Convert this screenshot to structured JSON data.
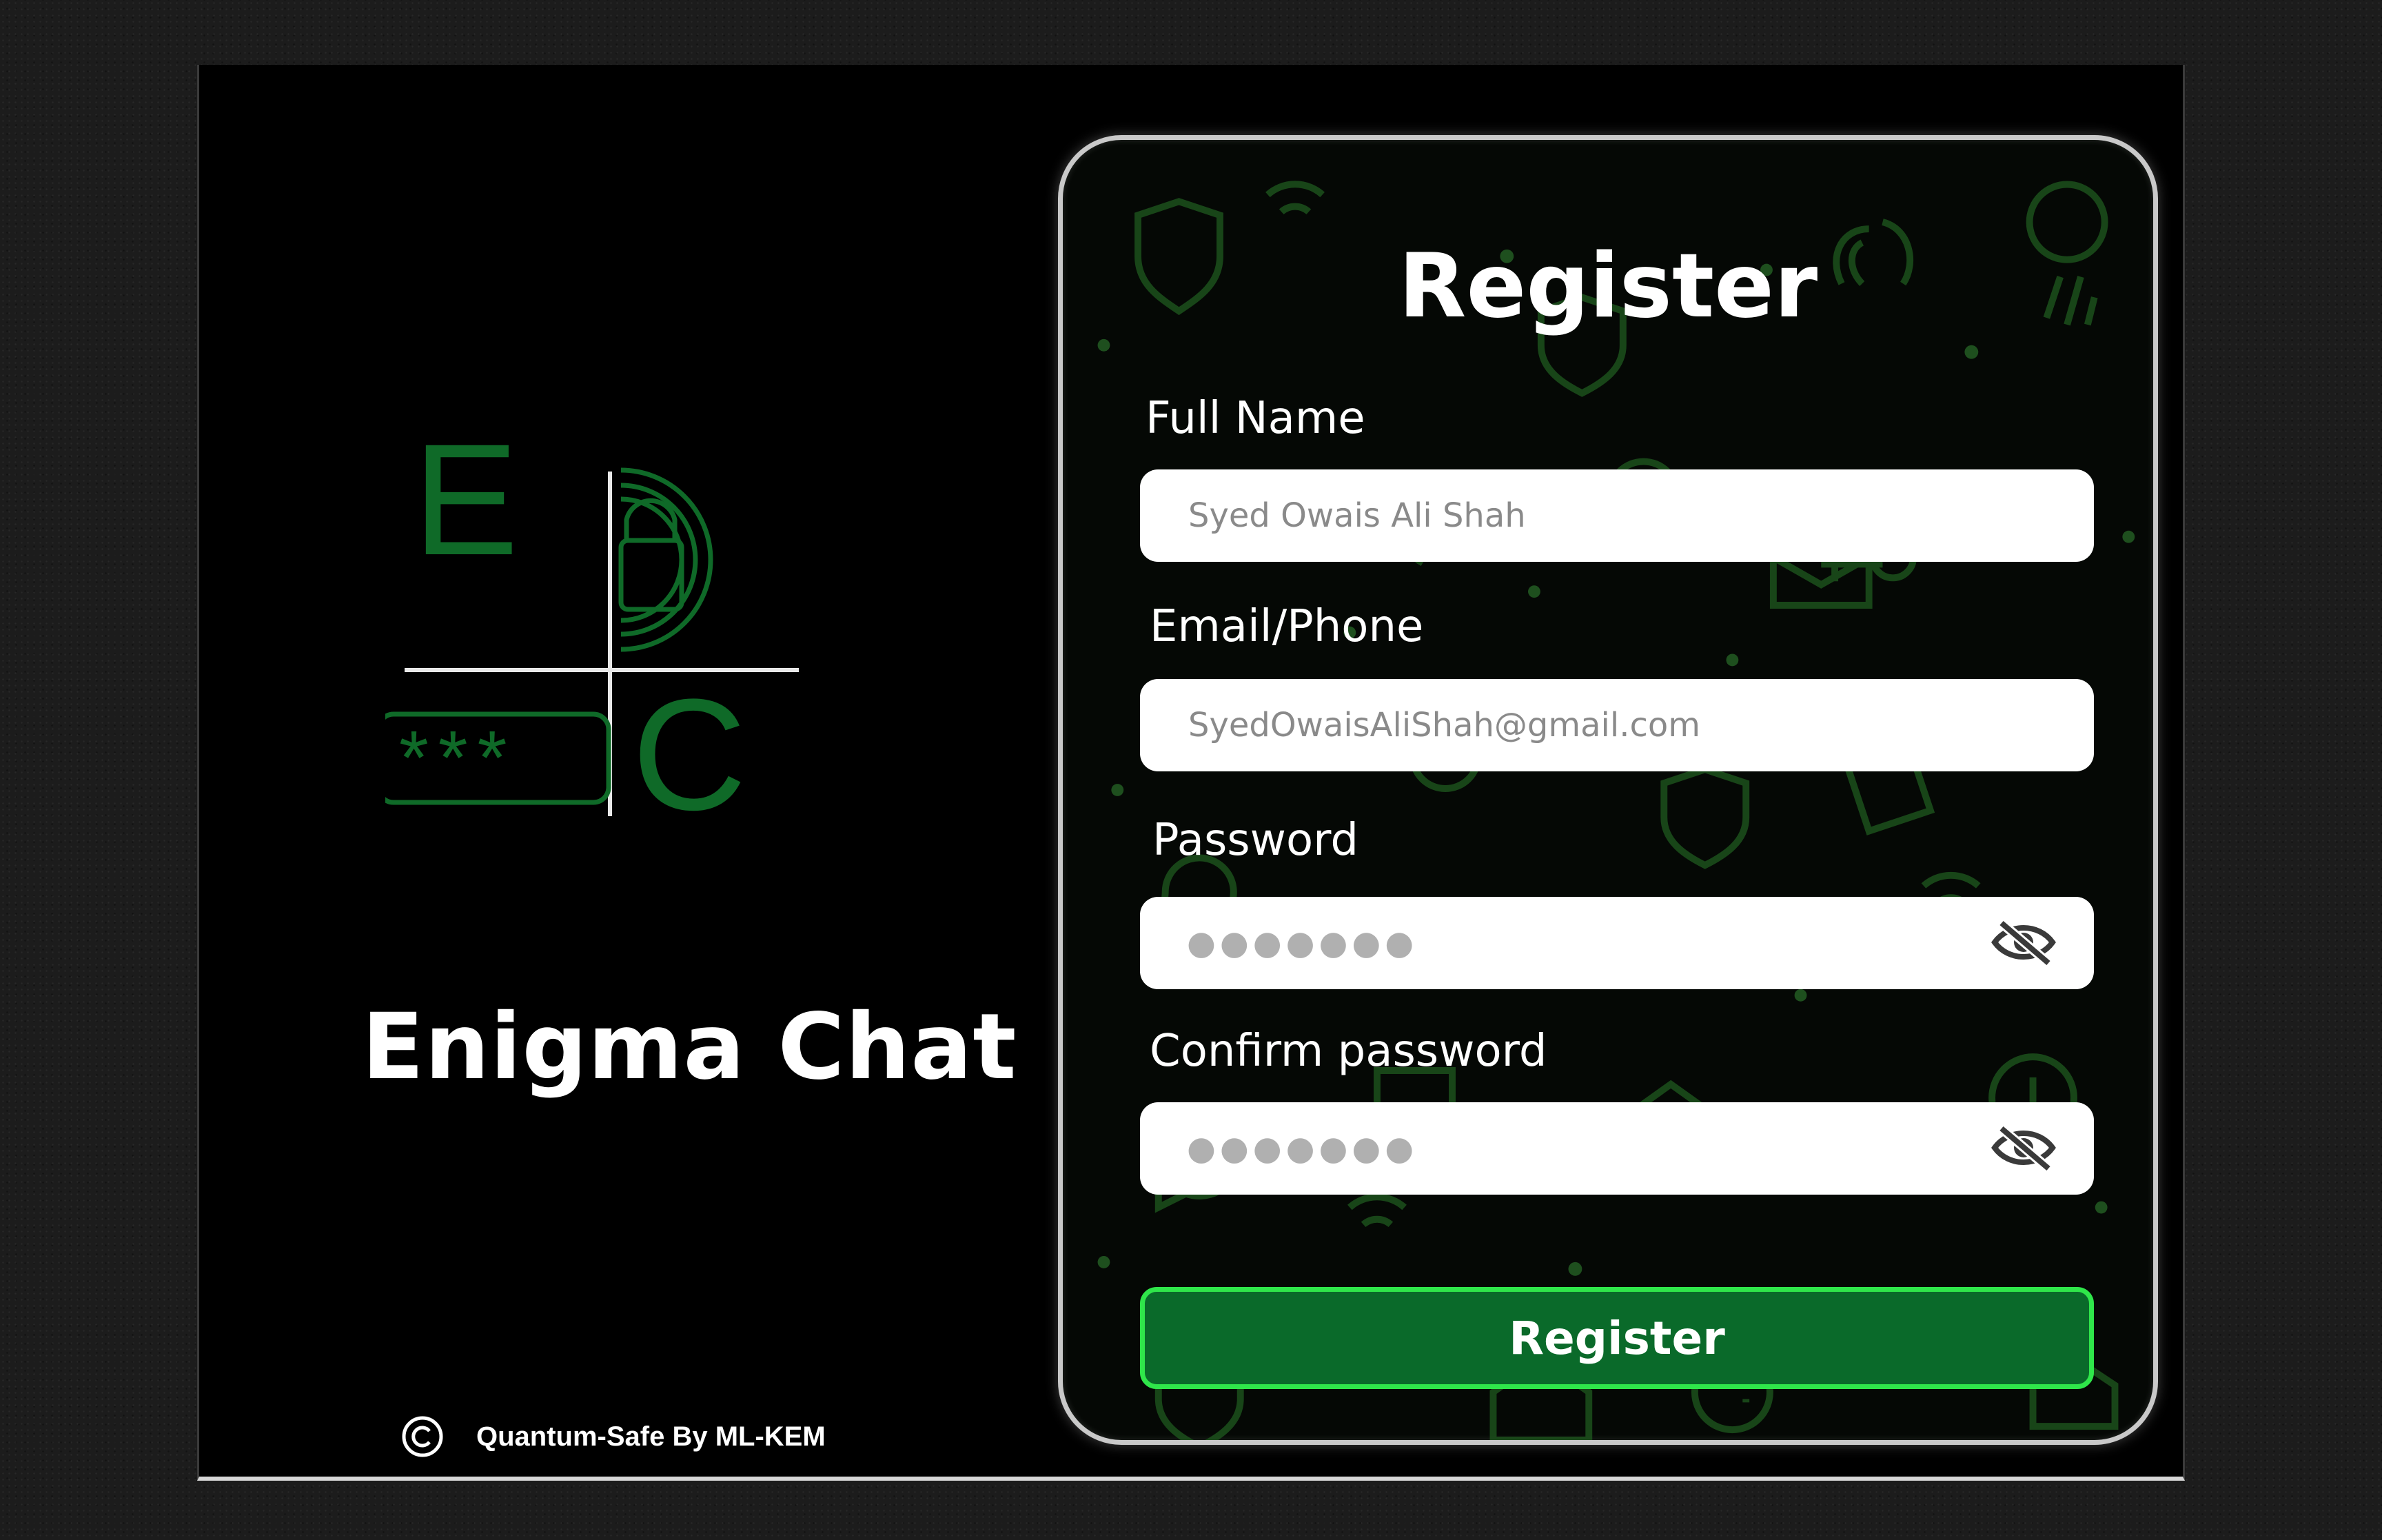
{
  "brand": {
    "title": "Enigma Chat",
    "logo_letters": [
      "E",
      "C"
    ],
    "password_mask": "***",
    "accent_color": "#0a6a2a",
    "icons": [
      "lock-icon",
      "copyright-icon"
    ]
  },
  "footer": {
    "note": "Quantum-Safe By ML-KEM"
  },
  "register": {
    "title": "Register",
    "fields": [
      {
        "label": "Full Name",
        "placeholder": "Syed Owais Ali Shah"
      },
      {
        "label": "Email/Phone",
        "placeholder": "SyedOwaisAliShah@gmail.com"
      },
      {
        "label": "Password",
        "masked": "●●●●●●●",
        "icon": "eye-off-icon"
      },
      {
        "label": "Confirm password",
        "masked": "●●●●●●●",
        "icon": "eye-off-icon"
      }
    ],
    "submit_label": "Register",
    "colors": {
      "button_fill": "#0a6a2a",
      "button_border": "#2fe64a",
      "pattern": "#1f6a1f"
    }
  }
}
